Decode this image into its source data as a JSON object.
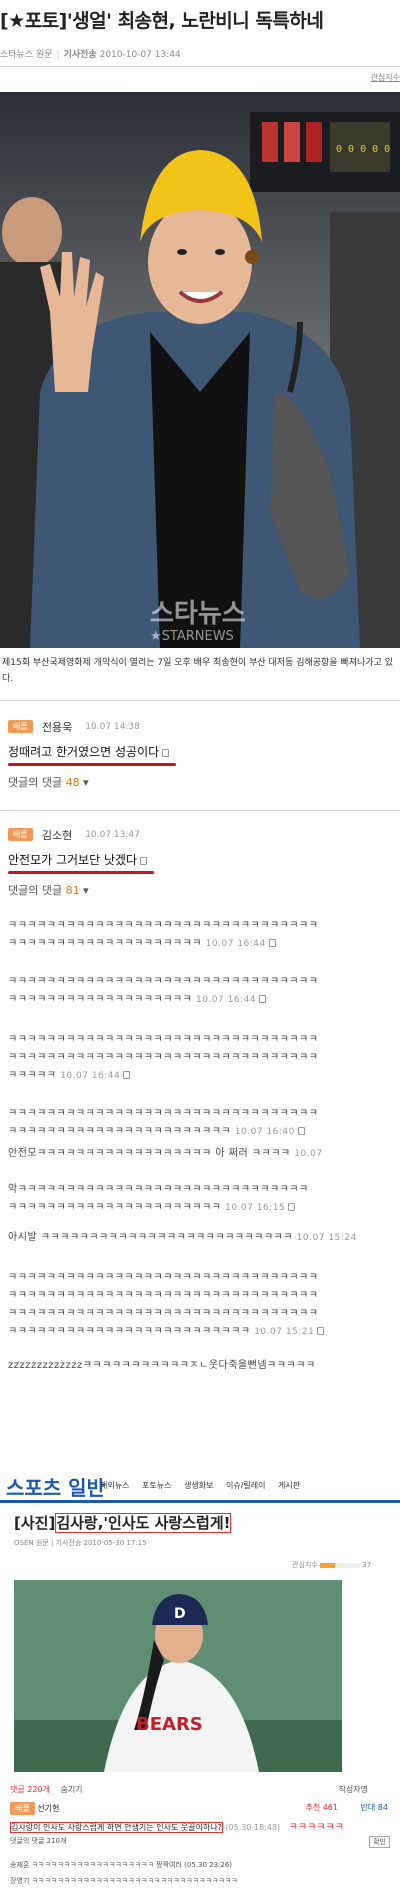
{
  "article": {
    "title": "[★포토]'생얼' 최송현, 노란비니 독특하네",
    "source": "스타뉴스 원문",
    "date_label": "기사전송",
    "date": "2010-10-07 13:44",
    "tag": "관심지수",
    "caption": "제15회 부산국제영화제 개막식이 열리는 7일 오후 배우 최송현이 부산 대저동 김해공항을 빠져나가고 있다.",
    "watermark_main": "스타뉴스",
    "watermark_sub": "★STARNEWS",
    "board_digits": "0 0 0 0 0"
  },
  "comments": [
    {
      "badge": "베플",
      "name": "전용욱",
      "time": "10.07 14:38",
      "text": "정때려고 한거였으면 성공이다",
      "reply_label": "댓글의 댓글",
      "reply_count": "48"
    },
    {
      "badge": "베플",
      "name": "김소현",
      "time": "10.07 13:47",
      "text": "안전모가 그거보단 낫겠다",
      "reply_label": "댓글의 댓글",
      "reply_count": "81"
    }
  ],
  "replies": [
    {
      "text": "ㅋㅋㅋㅋㅋㅋㅋㅋㅋㅋㅋㅋㅋㅋㅋㅋㅋㅋㅋㅋㅋㅋㅋㅋㅋㅋㅋㅋㅋㅋㅋㅋ",
      "time": ""
    },
    {
      "text": "ㅋㅋㅋㅋㅋㅋㅋㅋㅋㅋㅋㅋㅋㅋㅋㅋㅋㅋㅋㅋ",
      "time": "10.07 16:44"
    },
    {
      "text": "ㅋㅋㅋㅋㅋㅋㅋㅋㅋㅋㅋㅋㅋㅋㅋㅋㅋㅋㅋㅋㅋㅋㅋㅋㅋㅋㅋㅋㅋㅋㅋㅋ",
      "time": ""
    },
    {
      "text": "ㅋㅋㅋㅋㅋㅋㅋㅋㅋㅋㅋㅋㅋㅋㅋㅋㅋㅋㅋ",
      "time": "10.07 16:44"
    },
    {
      "text": "ㅋㅋㅋㅋㅋㅋㅋㅋㅋㅋㅋㅋㅋㅋㅋㅋㅋㅋㅋㅋㅋㅋㅋㅋㅋㅋㅋㅋㅋㅋㅋㅋ",
      "time": ""
    },
    {
      "text": "ㅋㅋㅋㅋㅋㅋㅋㅋㅋㅋㅋㅋㅋㅋㅋㅋㅋㅋㅋㅋㅋㅋㅋㅋㅋㅋㅋㅋㅋㅋㅋㅋ",
      "time": ""
    },
    {
      "text": "ㅋㅋㅋㅋㅋ",
      "time": "10.07 16:44"
    },
    {
      "text": "ㅋㅋㅋㅋㅋㅋㅋㅋㅋㅋㅋㅋㅋㅋㅋㅋㅋㅋㅋㅋㅋㅋㅋㅋㅋㅋㅋㅋㅋㅋㅋㅋ",
      "time": ""
    },
    {
      "text": "ㅋㅋㅋㅋㅋㅋㅋㅋㅋㅋㅋㅋㅋㅋㅋㅋㅋㅋㅋㅋㅋㅋㅋ",
      "time": "10.07 16:40"
    },
    {
      "text": "안전모ㅋㅋㅋㅋㅋㅋㅋㅋㅋㅋㅋㅋㅋㅋㅋㅋㅋㅋ 아 쩌러 ㅋㅋㅋㅋ",
      "time": "10.07"
    },
    {
      "text": "악ㅋㅋㅋㅋㅋㅋㅋㅋㅋㅋㅋㅋㅋㅋㅋㅋㅋㅋㅋㅋㅋㅋㅋㅋㅋㅋㅋㅋㅋㅋ",
      "time": ""
    },
    {
      "text": "ㅋㅋㅋㅋㅋㅋㅋㅋㅋㅋㅋㅋㅋㅋㅋㅋㅋㅋㅋㅋㅋㅋ",
      "time": "10.07 16:15"
    },
    {
      "text": "아시발 ㅋㅋㅋㅋㅋㅋㅋㅋㅋㅋㅋㅋㅋㅋㅋㅋㅋㅋㅋㅋㅋㅋㅋㅋㅋㅋ",
      "time": "10.07 15:24"
    },
    {
      "text": "ㅋㅋㅋㅋㅋㅋㅋㅋㅋㅋㅋㅋㅋㅋㅋㅋㅋㅋㅋㅋㅋㅋㅋㅋㅋㅋㅋㅋㅋㅋㅋㅋ",
      "time": ""
    },
    {
      "text": "ㅋㅋㅋㅋㅋㅋㅋㅋㅋㅋㅋㅋㅋㅋㅋㅋㅋㅋㅋㅋㅋㅋㅋㅋㅋㅋㅋㅋㅋㅋㅋㅋ",
      "time": ""
    },
    {
      "text": "ㅋㅋㅋㅋㅋㅋㅋㅋㅋㅋㅋㅋㅋㅋㅋㅋㅋㅋㅋㅋㅋㅋㅋㅋㅋㅋㅋㅋㅋㅋㅋㅋ",
      "time": ""
    },
    {
      "text": "ㅋㅋㅋㅋㅋㅋㅋㅋㅋㅋㅋㅋㅋㅋㅋㅋㅋㅋㅋㅋㅋㅋㅋㅋㅋ",
      "time": "10.07 15:21"
    },
    {
      "text": "zzzzzzzzzzzzzㅋㅋㅋㅋㅋㅋㅋㅋㅋㅋㅋㅈㄴ웃다죽을뻔넴ㅋㅋㅋㅋㅋ",
      "time": ""
    }
  ],
  "sports": {
    "section_title": "스포츠 일반",
    "nav": [
      "해외뉴스",
      "포토뉴스",
      "생생화보",
      "이슈/릴레이",
      "게시판"
    ],
    "headline_prefix": "[사진]",
    "headline_box": "김사랑,'인사도 사랑스럽게!",
    "meta": "OSEN 원문 | 기사전송 2010-05-30 17:15",
    "interest": "관심지수",
    "interest_value": "37",
    "jersey": "BEARS",
    "cap_letter": "D",
    "foot_left": "댓글 220개",
    "foot_mid": "숨기기",
    "foot_right": "작성자명",
    "cmt_label": "베플",
    "cmt_name": "선기현",
    "cmt_votes_up": "추천 461",
    "cmt_votes_down": "반대 84",
    "cmt_text": "김사랑이 인사도 사랑스럽게 하면 안생기는 인사도 웃끌이하나?",
    "cmt_time": "(05.30 18:48)",
    "cmt_reply": "ㅋㅋㅋㅋㅋㅋ",
    "reply_label": "댓글의 댓글 210개",
    "reply_btn": "확인",
    "rows": [
      {
        "name": "송재훈",
        "text": "ㅋㅋㅋㅋㅋㅋㅋㅋㅋㅋㅋㅋㅋㅋㅋㅋㅋㅋㅋ 짱짝여러 (05.30 23:26)"
      },
      {
        "name": "장영기",
        "text": "ㅋㅋㅋㅋㅋㅋㅋㅋㅋㅋㅋㅋㅋㅋㅋㅋㅋㅋㅋㅋㅋㅋㅋㅋㅋㅋㅋㅋㅋㅋㅋㅋ"
      }
    ]
  },
  "colors": {
    "accent_red": "#c4161c",
    "badge_orange": "#f09a5a",
    "sports_blue": "#1b5aa8"
  }
}
